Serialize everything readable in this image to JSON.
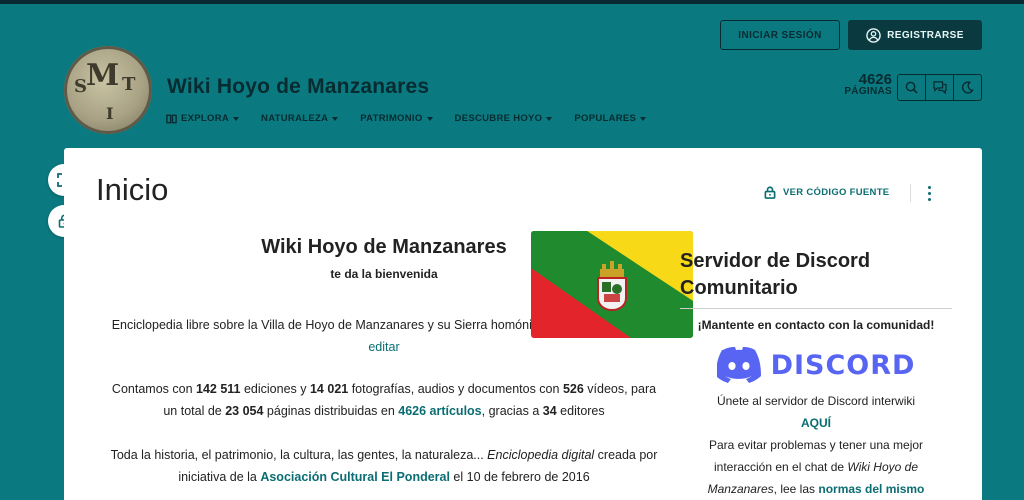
{
  "header": {
    "login_label": "INICIAR SESIÓN",
    "register_label": "REGISTRARSE",
    "site_title": "Wiki Hoyo de Manzanares",
    "page_count": "4626",
    "page_count_label": "PÁGINAS",
    "nav": [
      {
        "label": "EXPLORA",
        "icon": "explore-icon"
      },
      {
        "label": "NATURALEZA"
      },
      {
        "label": "PATRIMONIO"
      },
      {
        "label": "DESCUBRE HOYO"
      },
      {
        "label": "POPULARES"
      }
    ],
    "logo_letters": [
      "M",
      "S",
      "T",
      "I"
    ]
  },
  "article": {
    "title": "Inicio",
    "source_label": "VER CÓDIGO FUENTE"
  },
  "welcome": {
    "title": "Wiki Hoyo de Manzanares",
    "subtitle": "te da la bienvenida",
    "p1_a": "Enciclopedia libre sobre la Villa de Hoyo de Manzanares y su Sierra homónima, que ",
    "p1_link": "todos pueden editar",
    "p2_a": "Contamos con ",
    "p2_edits": "142 511",
    "p2_b": " ediciones y ",
    "p2_photos": "14 021",
    "p2_c": " fotografías, audios y documentos con ",
    "p2_videos": "526",
    "p2_d": " vídeos, para un total de ",
    "p2_pages": "23 054",
    "p2_e": " páginas distribuidas en ",
    "p2_articles": "4626 artículos",
    "p2_f": ", gracias a ",
    "p2_editors": "34",
    "p2_g": " editores",
    "p3_a": "Toda la historia, el patrimonio, la cultura, las gentes, la naturaleza... ",
    "p3_em": "Enciclopedia digital",
    "p3_b": " creada por iniciativa de la ",
    "p3_link": "Asociación Cultural El Ponderal",
    "p3_c": " el 10 de febrero de 2016"
  },
  "discord": {
    "title": "Servidor de Discord Comunitario",
    "keep": "¡Mantente en contacto con la comunidad!",
    "wordmark": "DISCORD",
    "join": "Únete al servidor de Discord interwiki",
    "here": "AQUÍ",
    "avoid_a": "Para evitar problemas y tener una mejor interacción en el chat de ",
    "avoid_em": "Wiki Hoyo de Manzanares",
    "avoid_b": ", lee las ",
    "avoid_link": "normas del mismo"
  },
  "colors": {
    "header_bg": "#0b7a80",
    "dark": "#062b30",
    "link": "#0b6d72",
    "discord": "#5865f2"
  }
}
